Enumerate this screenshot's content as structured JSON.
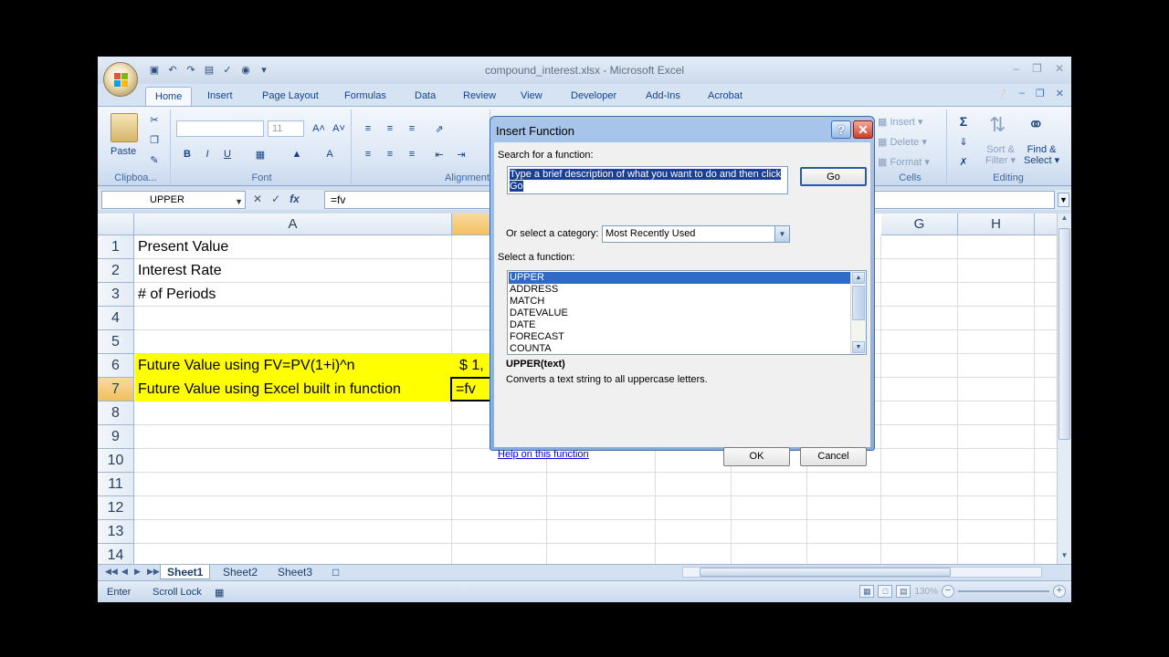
{
  "window": {
    "title": "compound_interest.xlsx - Microsoft Excel"
  },
  "ribbon": {
    "tabs": [
      "Home",
      "Insert",
      "Page Layout",
      "Formulas",
      "Data",
      "Review",
      "View",
      "Developer",
      "Add-Ins",
      "Acrobat"
    ],
    "active_tab": "Home",
    "clipboard": {
      "paste_label": "Paste",
      "group_label": "Clipboa..."
    },
    "font": {
      "size_value": "11",
      "group_label": "Font"
    },
    "alignment": {
      "group_label": "Alignment"
    },
    "cells": {
      "insert_label": "Insert",
      "delete_label": "Delete",
      "format_label": "Format",
      "group_label": "Cells"
    },
    "editing": {
      "sort_filter_line1": "Sort &",
      "sort_filter_line2": "Filter",
      "find_select_line1": "Find &",
      "find_select_line2": "Select",
      "group_label": "Editing"
    }
  },
  "formula_bar": {
    "name_box": "UPPER",
    "fx_label": "fx",
    "formula": "=fv"
  },
  "grid": {
    "columns": [
      "A",
      "G",
      "H"
    ],
    "rows": [
      "1",
      "2",
      "3",
      "4",
      "5",
      "6",
      "7",
      "8",
      "9",
      "10",
      "11",
      "12",
      "13",
      "14"
    ],
    "cells": {
      "A1": "Present Value",
      "A2": "Interest Rate",
      "A3": "# of  Periods",
      "A6": "Future Value using FV=PV(1+i)^n",
      "A7": "Future Value using Excel built in function",
      "B6": "$ 1,",
      "B7": "=fv"
    },
    "highlight_color": "#ffff00",
    "selected_header_color": "#f1c15f"
  },
  "sheets": {
    "tabs": [
      "Sheet1",
      "Sheet2",
      "Sheet3"
    ],
    "active": "Sheet1"
  },
  "status_bar": {
    "mode": "Enter",
    "scroll_lock": "Scroll Lock",
    "zoom": "130%"
  },
  "dialog": {
    "title": "Insert Function",
    "search_label": "Search for a function:",
    "search_value": "Type a brief description of what you want to do and then click Go",
    "go_button": "Go",
    "category_label": "Or select a category:",
    "category_value": "Most Recently Used",
    "select_label": "Select a function:",
    "functions": [
      "UPPER",
      "ADDRESS",
      "MATCH",
      "DATEVALUE",
      "DATE",
      "FORECAST",
      "COUNTA"
    ],
    "selected_function": "UPPER",
    "signature": "UPPER(text)",
    "description": "Converts a text string to all uppercase letters.",
    "help_link": "Help on this function",
    "ok_button": "OK",
    "cancel_button": "Cancel"
  }
}
